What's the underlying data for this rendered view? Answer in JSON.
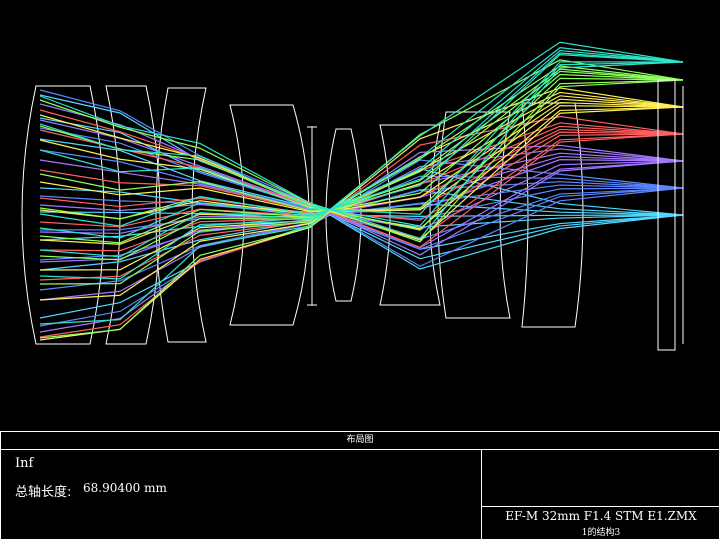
{
  "panel": {
    "title": "布局图",
    "field": "Inf",
    "length_label": "总轴长度:",
    "length_value": "68.90400 mm",
    "filename": "EF-M 32mm F1.4 STM E1.ZMX",
    "config": "1的结构3"
  },
  "diagram": {
    "background": "#000000",
    "element_color": "#ffffff",
    "ray_colors": [
      "#4fd8ff",
      "#5b86ff",
      "#a377ff",
      "#ff5f5f",
      "#ffef55",
      "#8cff5a",
      "#2fe3c8"
    ]
  }
}
